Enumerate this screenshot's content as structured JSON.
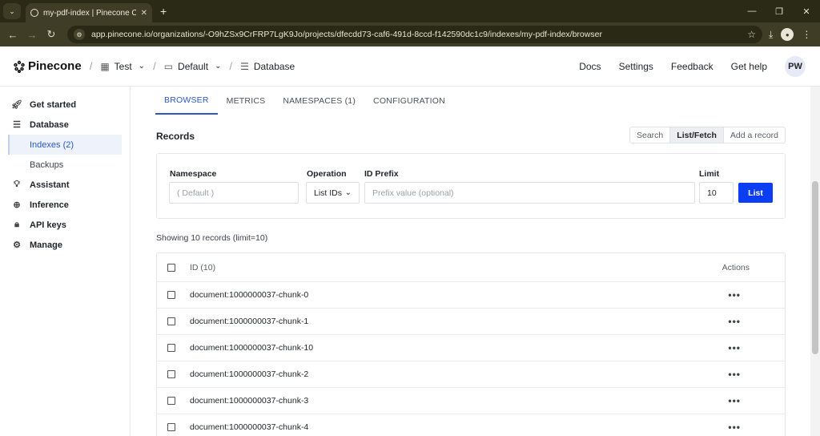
{
  "browser": {
    "tab_title": "my-pdf-index | Pinecone Conso",
    "url": "app.pinecone.io/organizations/-O9hZSx9CrFRP7LgK9Jo/projects/dfecdd73-caf6-491d-8ccd-f142590dc1c9/indexes/my-pdf-index/browser"
  },
  "header": {
    "brand": "Pinecone",
    "breadcrumb": [
      {
        "label": "Test",
        "icon": "building-icon"
      },
      {
        "label": "Default",
        "icon": "folder-icon"
      },
      {
        "label": "Database",
        "icon": "database-icon"
      }
    ],
    "links": [
      "Docs",
      "Settings",
      "Feedback",
      "Get help"
    ],
    "avatar": "PW"
  },
  "sidebar": {
    "items": [
      {
        "label": "Get started",
        "icon": "rocket-icon"
      },
      {
        "label": "Database",
        "icon": "database-icon"
      },
      {
        "label": "Indexes (2)",
        "sub": true,
        "active": true
      },
      {
        "label": "Backups",
        "sub": true
      },
      {
        "label": "Assistant",
        "icon": "lightbulb-icon"
      },
      {
        "label": "Inference",
        "icon": "inference-icon"
      },
      {
        "label": "API keys",
        "icon": "lock-icon"
      },
      {
        "label": "Manage",
        "icon": "gear-icon"
      }
    ]
  },
  "tabs": [
    "BROWSER",
    "METRICS",
    "NAMESPACES (1)",
    "CONFIGURATION"
  ],
  "records": {
    "title": "Records",
    "modes": [
      "Search",
      "List/Fetch",
      "Add a record"
    ],
    "active_mode": "List/Fetch",
    "form": {
      "namespace_label": "Namespace",
      "namespace_placeholder": "( Default )",
      "operation_label": "Operation",
      "operation_value": "List IDs",
      "prefix_label": "ID Prefix",
      "prefix_placeholder": "Prefix value (optional)",
      "limit_label": "Limit",
      "limit_value": "10",
      "list_button": "List"
    },
    "showing": "Showing 10 records (limit=10)",
    "table": {
      "id_header": "ID (10)",
      "actions_header": "Actions",
      "rows": [
        "document:1000000037-chunk-0",
        "document:1000000037-chunk-1",
        "document:1000000037-chunk-10",
        "document:1000000037-chunk-2",
        "document:1000000037-chunk-3",
        "document:1000000037-chunk-4"
      ]
    }
  },
  "colors": {
    "accent": "#2b57c9",
    "primary_button": "#0b3df5",
    "chrome": "#3f3d25"
  }
}
